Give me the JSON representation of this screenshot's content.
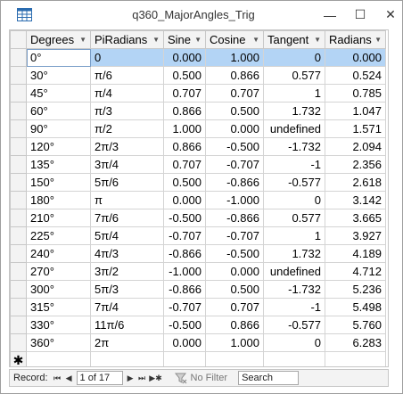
{
  "window": {
    "title": "q360_MajorAngles_Trig",
    "minimize_glyph": "—",
    "maximize_glyph": "☐",
    "close_glyph": "✕"
  },
  "datasheet": {
    "columns": [
      "Degrees",
      "PiRadians",
      "Sine",
      "Cosine",
      "Tangent",
      "Radians"
    ],
    "rows": [
      [
        "0°",
        "0",
        "0.000",
        "1.000",
        "0",
        "0.000"
      ],
      [
        "30°",
        "π/6",
        "0.500",
        "0.866",
        "0.577",
        "0.524"
      ],
      [
        "45°",
        "π/4",
        "0.707",
        "0.707",
        "1",
        "0.785"
      ],
      [
        "60°",
        "π/3",
        "0.866",
        "0.500",
        "1.732",
        "1.047"
      ],
      [
        "90°",
        "π/2",
        "1.000",
        "0.000",
        "undefined",
        "1.571"
      ],
      [
        "120°",
        "2π/3",
        "0.866",
        "-0.500",
        "-1.732",
        "2.094"
      ],
      [
        "135°",
        "3π/4",
        "0.707",
        "-0.707",
        "-1",
        "2.356"
      ],
      [
        "150°",
        "5π/6",
        "0.500",
        "-0.866",
        "-0.577",
        "2.618"
      ],
      [
        "180°",
        "π",
        "0.000",
        "-1.000",
        "0",
        "3.142"
      ],
      [
        "210°",
        "7π/6",
        "-0.500",
        "-0.866",
        "0.577",
        "3.665"
      ],
      [
        "225°",
        "5π/4",
        "-0.707",
        "-0.707",
        "1",
        "3.927"
      ],
      [
        "240°",
        "4π/3",
        "-0.866",
        "-0.500",
        "1.732",
        "4.189"
      ],
      [
        "270°",
        "3π/2",
        "-1.000",
        "0.000",
        "undefined",
        "4.712"
      ],
      [
        "300°",
        "5π/3",
        "-0.866",
        "0.500",
        "-1.732",
        "5.236"
      ],
      [
        "315°",
        "7π/4",
        "-0.707",
        "0.707",
        "-1",
        "5.498"
      ],
      [
        "330°",
        "11π/6",
        "-0.500",
        "0.866",
        "-0.577",
        "5.760"
      ],
      [
        "360°",
        "2π",
        "0.000",
        "1.000",
        "0",
        "6.283"
      ]
    ],
    "new_row_marker": "✱",
    "current_row_index": 0
  },
  "navigation": {
    "record_label": "Record:",
    "first_glyph": "⏮",
    "prev_glyph": "◀",
    "record_position": "1 of 17",
    "next_glyph": "▶",
    "last_glyph": "⏭",
    "new_glyph": "▶✱",
    "filter_label": "No Filter",
    "search_value": "Search"
  },
  "colors": {
    "selection": "#b3d4f5",
    "header_bg": "#f3f3f3"
  }
}
